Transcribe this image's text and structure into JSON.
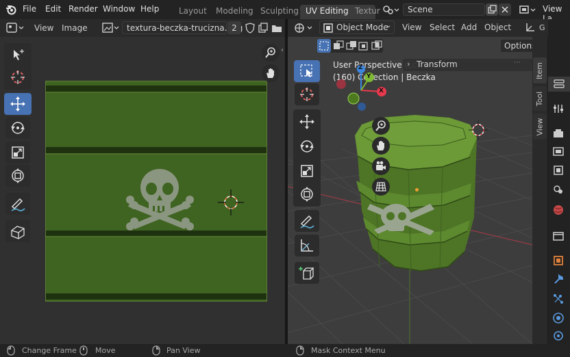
{
  "topbar": {
    "menus": [
      "File",
      "Edit",
      "Render",
      "Window",
      "Help"
    ],
    "workspaces": [
      "Layout",
      "Modeling",
      "Sculpting",
      "UV Editing",
      "Textur"
    ],
    "active_workspace": "UV Editing",
    "scene_label": "Scene",
    "view_layer_label": "View La"
  },
  "image_editor": {
    "view_menu": "View",
    "image_menu": "Image",
    "image_name": "textura-beczka-trucizna.png",
    "user_count": "2"
  },
  "viewport": {
    "mode": "Object Mode",
    "menus": [
      "View",
      "Select",
      "Add",
      "Object"
    ],
    "options_label": "Options",
    "overlay_title": "User Perspective (Lc",
    "overlay_collection": "(160) Collection | Beczka",
    "transform_label": "Transform",
    "gizmo_axes": [
      "Y",
      "Z",
      "X"
    ]
  },
  "sidebar_tabs": [
    "Item",
    "Tool",
    "View"
  ],
  "statusbar": {
    "change_frame": "Change Frame",
    "move": "Move",
    "pan_view": "Pan View",
    "mask_context_menu": "Mask Context Menu"
  },
  "colors": {
    "accent": "#4772b3",
    "texture_green": "#3f6320",
    "axis_x": "#e8394d",
    "axis_y": "#7fb833",
    "axis_z": "#3d87e0"
  },
  "icons": {
    "blender_logo": "blender-logo-icon",
    "select_box": "select-box-icon",
    "cursor": "cursor-icon",
    "move": "move-icon",
    "rotate": "rotate-icon",
    "scale": "scale-icon",
    "transform": "transform-icon",
    "annotate": "annotate-icon",
    "measure": "measure-icon",
    "add_cube": "add-cube-icon",
    "zoom": "zoom-icon",
    "hand": "hand-icon",
    "camera": "camera-icon",
    "grid": "grid-icon"
  }
}
